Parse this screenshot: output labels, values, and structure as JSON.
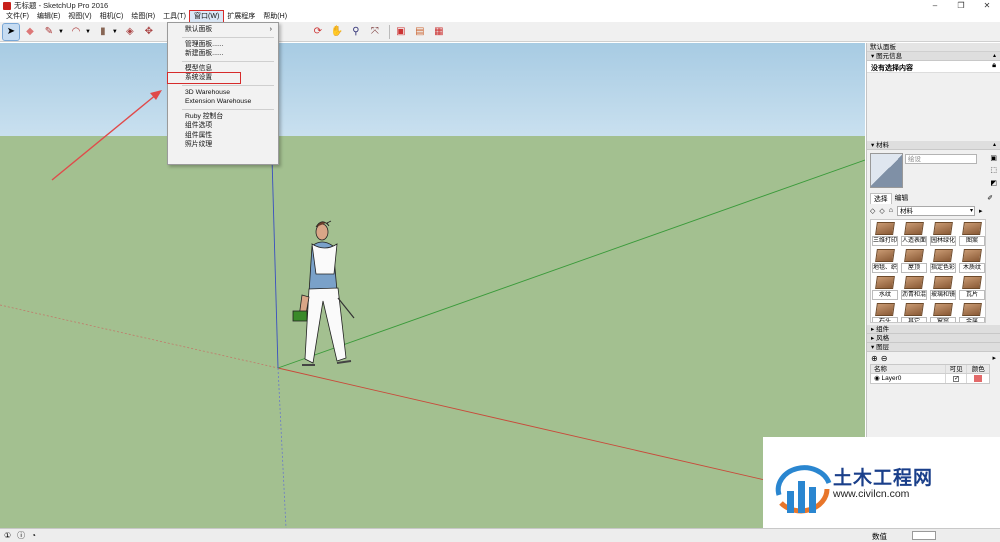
{
  "window": {
    "title": "无标题 - SketchUp Pro 2016",
    "controls": [
      "–",
      "❐",
      "✕"
    ]
  },
  "menubar": {
    "items": [
      "文件(F)",
      "编辑(E)",
      "视图(V)",
      "相机(C)",
      "绘图(R)",
      "工具(T)",
      "窗口(W)",
      "扩展程序",
      "帮助(H)"
    ],
    "active_index": 6
  },
  "window_menu": {
    "group1": [
      "默认面板"
    ],
    "group2": [
      "管理面板......",
      "新建面板......"
    ],
    "group3": [
      "模型信息",
      "系统设置"
    ],
    "group4": [
      "3D Warehouse",
      "Extension Warehouse"
    ],
    "group5": [
      "Ruby 控制台",
      "组件选项",
      "组件属性",
      "照片纹理"
    ],
    "submenu_arrow": "›",
    "highlighted": "系统设置"
  },
  "tray": {
    "title": "默认面板",
    "entity_info": {
      "header": "图元信息",
      "status": "没有选择内容"
    },
    "materials": {
      "header": "材料",
      "name_placeholder": "绘设",
      "tabs": [
        "选择",
        "编辑"
      ],
      "library": "材料",
      "swatches": [
        "三维打印",
        "人造表面",
        "园林绿化",
        "图案",
        "地毯、织",
        "屋顶",
        "指定色彩",
        "木质纹",
        "水纹",
        "沥青和混",
        "玻璃和镜",
        "瓦片",
        "石头",
        "其它",
        "窗帘",
        "金属"
      ]
    },
    "collapsed_panels": [
      "组件",
      "风格"
    ],
    "layers": {
      "header": "图层",
      "columns": [
        "名称",
        "可见",
        "颜色"
      ],
      "rows": [
        {
          "name": "Layer0",
          "visible": "✓",
          "color": "#e36a6a"
        }
      ]
    }
  },
  "watermark": {
    "title": "土木工程网",
    "url": "www.civilcn.com"
  },
  "statusbar": {
    "measure_label": "数值"
  },
  "colors": {
    "menu_highlight": "#d62b2b",
    "ground": "#a3c090",
    "sky": "#a7cbe3"
  }
}
